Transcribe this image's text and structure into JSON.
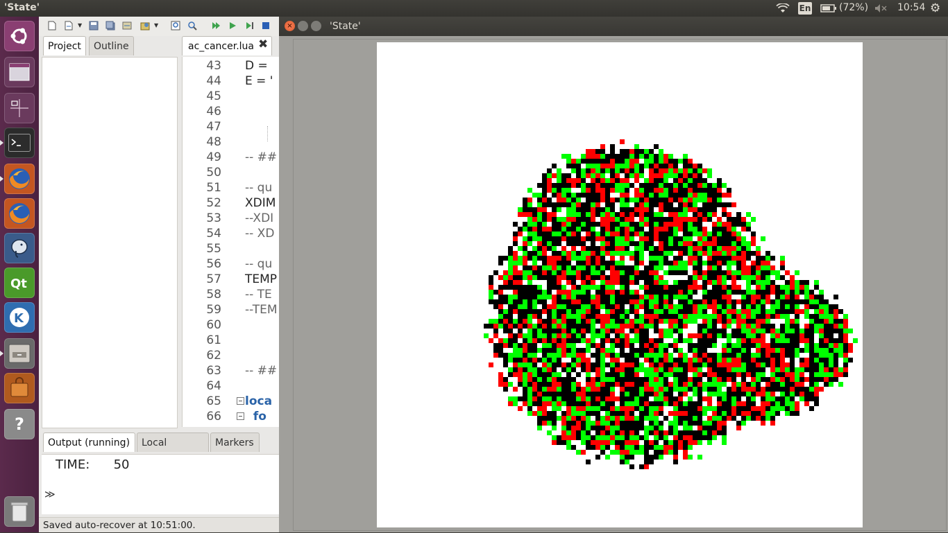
{
  "top_panel": {
    "title": "'State'",
    "keyboard": "En",
    "battery": "(72%)",
    "clock": "10:54"
  },
  "launcher": {
    "items": [
      {
        "name": "dash-home",
        "icon": "ubuntu-logo-icon",
        "color": "#8a3f72"
      },
      {
        "name": "workspace-switcher",
        "icon": "workspaces-icon",
        "color": "#6a3a5d"
      },
      {
        "name": "window-spread",
        "icon": "spread-icon",
        "color": "#6a3a5d"
      },
      {
        "name": "terminal",
        "icon": "terminal-icon",
        "color": "#2b2b2b"
      },
      {
        "name": "firefox-1",
        "icon": "firefox-icon",
        "color": "#c45621"
      },
      {
        "name": "firefox-2",
        "icon": "firefox-icon",
        "color": "#c45621"
      },
      {
        "name": "pgadmin",
        "icon": "elephant-icon",
        "color": "#3a5b8a"
      },
      {
        "name": "qt-creator",
        "icon": "qt-icon",
        "color": "#4a9a2a"
      },
      {
        "name": "kde-app",
        "icon": "k-icon",
        "color": "#2f6db0"
      },
      {
        "name": "file-manager",
        "icon": "drawer-icon",
        "color": "#6a6a6a"
      },
      {
        "name": "software-center",
        "icon": "bag-icon",
        "color": "#b05a1e"
      },
      {
        "name": "help",
        "icon": "help-icon",
        "color": "#8a8a8a"
      },
      {
        "name": "trash",
        "icon": "trash-icon",
        "color": "#7a7a7a"
      }
    ],
    "help_glyph": "?"
  },
  "ide": {
    "tabs": {
      "project": "Project",
      "outline": "Outline"
    },
    "editor_tab": "ac_cancer.lua",
    "code_lines": [
      {
        "n": "43",
        "t": "D = ",
        "k": "code"
      },
      {
        "n": "44",
        "t": "E = '",
        "k": "code"
      },
      {
        "n": "45",
        "t": "",
        "k": "code"
      },
      {
        "n": "46",
        "t": "",
        "k": "code"
      },
      {
        "n": "47",
        "t": "",
        "k": "code"
      },
      {
        "n": "48",
        "t": "",
        "k": "code"
      },
      {
        "n": "49",
        "t": "-- ##",
        "k": "comment"
      },
      {
        "n": "50",
        "t": "",
        "k": "code"
      },
      {
        "n": "51",
        "t": "-- qu",
        "k": "comment"
      },
      {
        "n": "52",
        "t": "XDIM",
        "k": "code"
      },
      {
        "n": "53",
        "t": "--XDI",
        "k": "comment"
      },
      {
        "n": "54",
        "t": "-- XD",
        "k": "comment"
      },
      {
        "n": "55",
        "t": "",
        "k": "code"
      },
      {
        "n": "56",
        "t": "-- qu",
        "k": "comment"
      },
      {
        "n": "57",
        "t": "TEMP",
        "k": "code"
      },
      {
        "n": "58",
        "t": "-- TE",
        "k": "comment"
      },
      {
        "n": "59",
        "t": "--TEM",
        "k": "comment"
      },
      {
        "n": "60",
        "t": "",
        "k": "code"
      },
      {
        "n": "61",
        "t": "",
        "k": "code"
      },
      {
        "n": "62",
        "t": "",
        "k": "code"
      },
      {
        "n": "63",
        "t": "-- ##",
        "k": "comment"
      },
      {
        "n": "64",
        "t": "",
        "k": "code"
      },
      {
        "n": "65",
        "t": "loca",
        "k": "kw",
        "fold": true
      },
      {
        "n": "66",
        "t": "  fo",
        "k": "kw",
        "fold": true
      }
    ],
    "output_tabs": {
      "output": "Output (running)",
      "console": "Local console",
      "markers": "Markers"
    },
    "output_text": "TIME:      50",
    "prompt": "≫",
    "status": "Saved auto-recover at 10:51:00."
  },
  "state_window": {
    "title": "'State'",
    "close_glyph": "×",
    "colors": {
      "alive": "#00ff00",
      "dead": "#ff0000",
      "other": "#000000"
    }
  }
}
